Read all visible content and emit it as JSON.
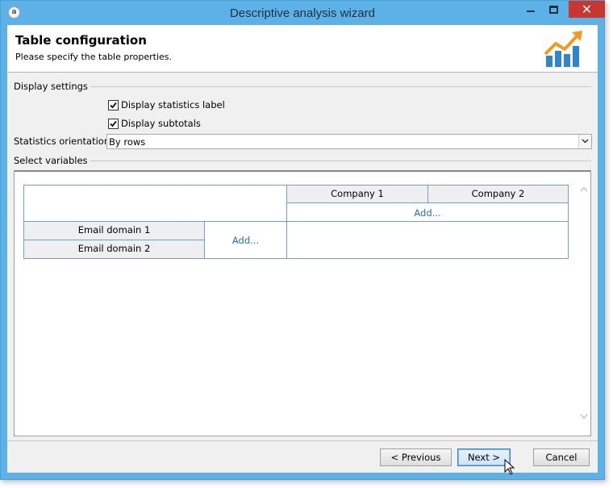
{
  "window": {
    "title": "Descriptive analysis wizard",
    "close_glyph": "✕"
  },
  "header": {
    "title": "Table configuration",
    "subtitle": "Please specify the table properties.",
    "logo_icon": "chart-growth-icon"
  },
  "display_settings": {
    "label": "Display settings",
    "options": [
      {
        "label": "Display statistics label",
        "checked": true
      },
      {
        "label": "Display subtotals",
        "checked": true
      }
    ]
  },
  "orientation": {
    "label": "Statistics orientation:",
    "value": "By rows"
  },
  "variables": {
    "label": "Select variables",
    "columns": [
      "Company 1",
      "Company 2"
    ],
    "column_add": "Add...",
    "rows": [
      "Email domain 1",
      "Email domain 2"
    ],
    "row_add": "Add..."
  },
  "buttons": {
    "previous": "< Previous",
    "next": "Next >",
    "cancel": "Cancel"
  },
  "colors": {
    "titlebar": "#5cb2e6",
    "close": "#c7372f",
    "link": "#2a6db5",
    "table_border": "#6e9fd6"
  }
}
